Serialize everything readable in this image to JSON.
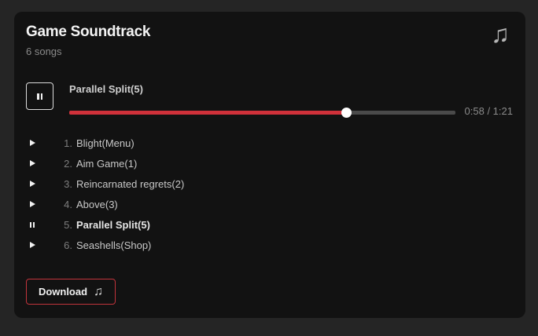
{
  "player": {
    "title": "Game Soundtrack",
    "subtitle": "6 songs",
    "header_icon": "music-note-icon",
    "now_playing": "Parallel Split(5)",
    "time": "0:58 / 1:21",
    "progress": 0.7162,
    "state": "playing",
    "accent_color": "#d0313a"
  },
  "tracks": [
    {
      "number": "1.",
      "name": "Blight(Menu)",
      "state": "paused"
    },
    {
      "number": "2.",
      "name": "Aim Game(1)",
      "state": "paused"
    },
    {
      "number": "3.",
      "name": "Reincarnated regrets(2)",
      "state": "paused"
    },
    {
      "number": "4.",
      "name": "Above(3)",
      "state": "paused"
    },
    {
      "number": "5.",
      "name": "Parallel Split(5)",
      "state": "playing"
    },
    {
      "number": "6.",
      "name": "Seashells(Shop)",
      "state": "paused"
    }
  ],
  "download": {
    "label": "Download",
    "icon": "music-note-icon"
  }
}
